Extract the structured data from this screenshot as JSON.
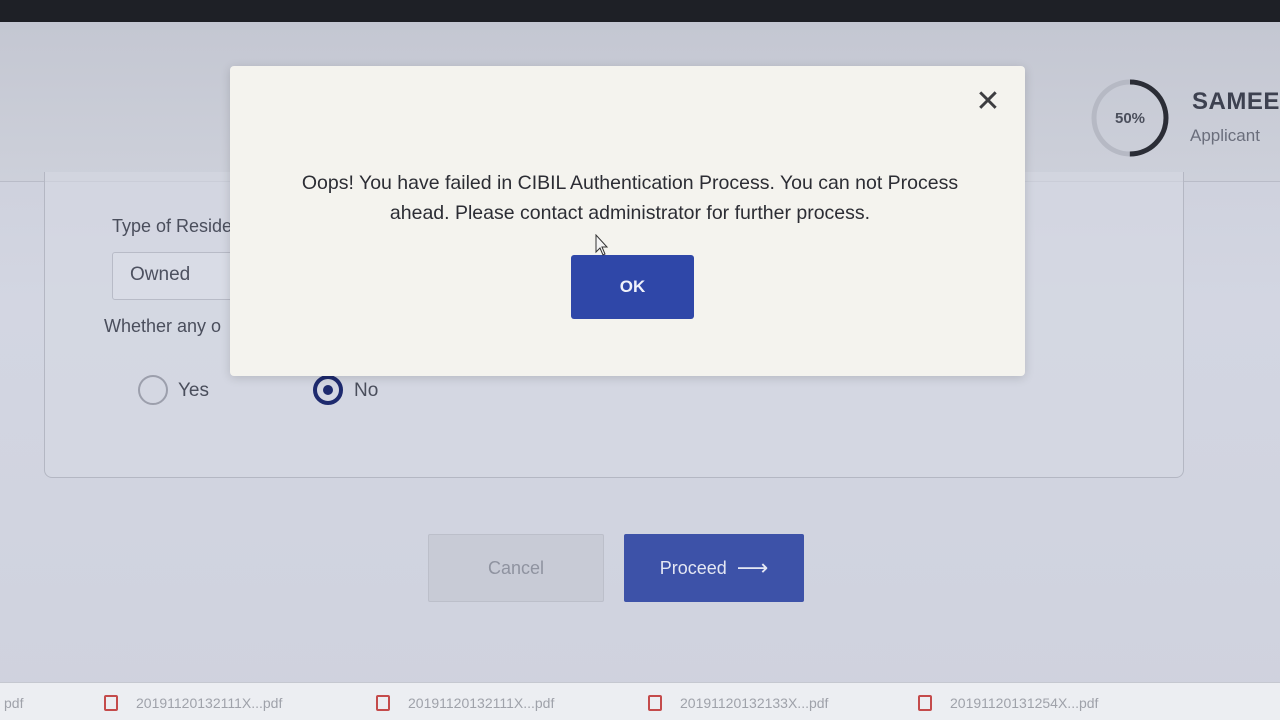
{
  "header": {
    "progress_value": 0.5,
    "progress_label": "50%",
    "user_name": "SAMEE",
    "user_role": "Applicant"
  },
  "form": {
    "residence_label": "Type of Reside",
    "residence_value": "Owned",
    "question_label": "Whether any o",
    "radio_yes_label": "Yes",
    "radio_no_label": "No",
    "selected_option": "No"
  },
  "actions": {
    "cancel_label": "Cancel",
    "proceed_label": "Proceed",
    "proceed_arrow": "⟶"
  },
  "modal": {
    "close_glyph": "✕",
    "message": "Oops! You have failed in CIBIL Authentication Process. You can not Process ahead. Please contact administrator for further process.",
    "ok_label": "OK"
  },
  "downloads": [
    {
      "name": "pdf"
    },
    {
      "name": "20191120132111X...pdf"
    },
    {
      "name": "20191120132111X...pdf"
    },
    {
      "name": "20191120132133X...pdf"
    },
    {
      "name": "20191120131254X...pdf"
    }
  ],
  "colors": {
    "primary": "#2f47a8",
    "progress_track": "#b6b9c4",
    "progress_fill": "#2b2d36"
  }
}
